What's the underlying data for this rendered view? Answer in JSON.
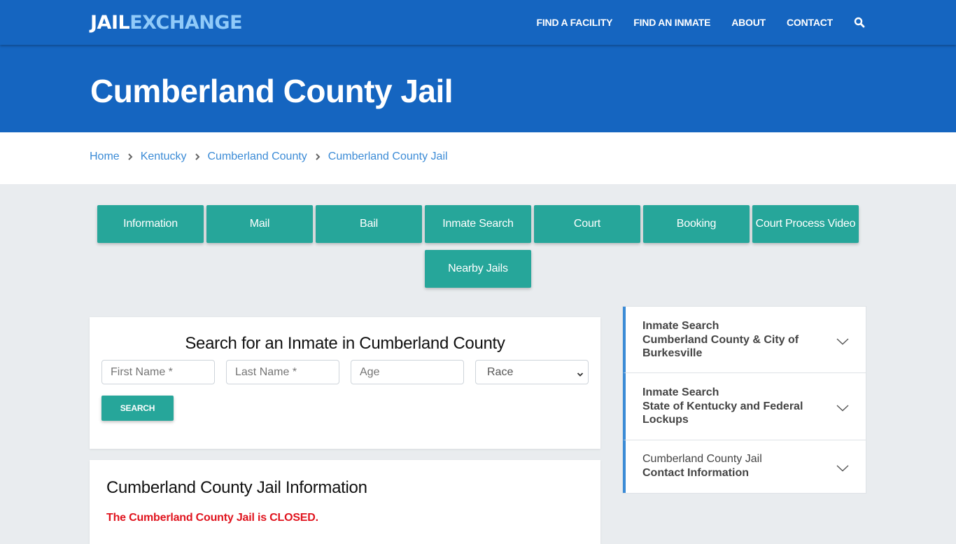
{
  "brand": {
    "part1": "JAIL",
    "part2": "EXCHANGE"
  },
  "nav": {
    "links": [
      "FIND A FACILITY",
      "FIND AN INMATE",
      "ABOUT",
      "CONTACT"
    ],
    "search_icon": "search-icon"
  },
  "hero": {
    "title": "Cumberland County Jail"
  },
  "breadcrumb": {
    "items": [
      "Home",
      "Kentucky",
      "Cumberland County",
      "Cumberland County Jail"
    ],
    "separator_icon": "chevron-right-icon"
  },
  "tiles": [
    "Information",
    "Mail",
    "Bail",
    "Inmate Search",
    "Court",
    "Booking",
    "Court Process Video",
    "Nearby Jails"
  ],
  "search_form": {
    "title": "Search for an Inmate in Cumberland County",
    "first_name_placeholder": "First Name *",
    "last_name_placeholder": "Last Name *",
    "age_placeholder": "Age",
    "race_selected": "Race",
    "submit_label": "SEARCH"
  },
  "info": {
    "title": "Cumberland County Jail Information",
    "closed_notice": "The Cumberland County Jail is CLOSED."
  },
  "accordion": [
    {
      "line1": "Inmate Search",
      "line2": "Cumberland County & City of Burkesville"
    },
    {
      "line1": "Inmate Search",
      "line2": "State of Kentucky and Federal Lockups"
    },
    {
      "line1": "Cumberland County Jail",
      "line2": "Contact Information"
    }
  ],
  "colors": {
    "primary_blue": "#1565c0",
    "logo_accent": "#90caf9",
    "teal": "#26a69a",
    "link_blue": "#3b8bd6",
    "closed_red": "#e0141e"
  }
}
